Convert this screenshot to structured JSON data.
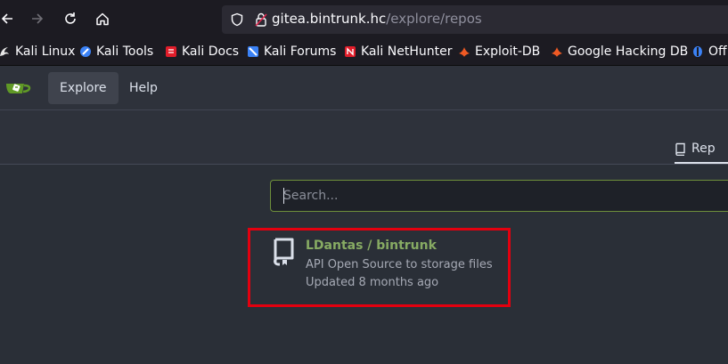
{
  "browser": {
    "url_host": "gitea.bintrunk.hc",
    "url_path": "/explore/repos"
  },
  "bookmarks": [
    {
      "label": "Kali Linux",
      "icon": "kali-dragon-icon",
      "color": "#e6e6e6"
    },
    {
      "label": "Kali Tools",
      "icon": "kali-tools-icon",
      "color": "#3b82f6"
    },
    {
      "label": "Kali Docs",
      "icon": "kali-docs-icon",
      "color": "#e11d2a"
    },
    {
      "label": "Kali Forums",
      "icon": "kali-forums-icon",
      "color": "#3b82f6"
    },
    {
      "label": "Kali NetHunter",
      "icon": "kali-nethunter-icon",
      "color": "#e11d2a"
    },
    {
      "label": "Exploit-DB",
      "icon": "exploit-db-icon",
      "color": "#ef5a24"
    },
    {
      "label": "Google Hacking DB",
      "icon": "ghdb-icon",
      "color": "#ef5a24"
    },
    {
      "label": "Off",
      "icon": "offsec-icon",
      "color": "#3b82f6"
    }
  ],
  "gitea_nav": {
    "items": [
      {
        "label": "Explore",
        "active": true
      },
      {
        "label": "Help",
        "active": false
      }
    ]
  },
  "tabs": {
    "repositories_label": "Rep"
  },
  "search": {
    "placeholder": "Search..."
  },
  "repo": {
    "title": "LDantas / bintrunk",
    "description": "API Open Source to storage files",
    "updated": "Updated 8 months ago"
  },
  "colors": {
    "accent_green": "#87ab63",
    "highlight_red": "#e3000f",
    "background": "#2a2f37"
  }
}
